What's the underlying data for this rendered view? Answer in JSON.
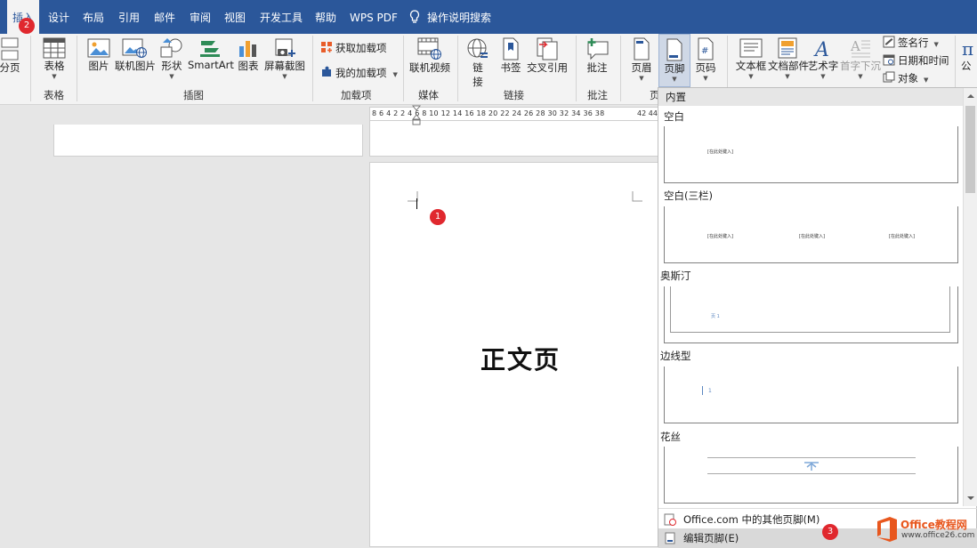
{
  "tabs": [
    "插入",
    "设计",
    "布局",
    "引用",
    "邮件",
    "审阅",
    "视图",
    "开发工具",
    "帮助",
    "WPS PDF",
    "操作说明搜索"
  ],
  "ribbon": {
    "page_break": "分页",
    "table": "表格",
    "picture": "图片",
    "online_picture": "联机图片",
    "shapes": "形状",
    "smartart": "SmartArt",
    "chart": "图表",
    "screenshot": "屏幕截图",
    "get_addins": "获取加载项",
    "my_addins": "我的加载项",
    "online_video": "联机视频",
    "link_1": "链",
    "link_2": "接",
    "bookmark": "书签",
    "cross_ref": "交叉引用",
    "comment": "批注",
    "header": "页眉",
    "footer": "页脚",
    "page_number": "页码",
    "textbox": "文本框",
    "quick_parts": "文档部件",
    "wordart": "艺术字",
    "dropcap": "首字下沉",
    "signature": "签名行",
    "datetime": "日期和时间",
    "object": "对象",
    "equation": "公"
  },
  "groups": {
    "tables": "表格",
    "illustrations": "插图",
    "addins": "加载项",
    "media": "媒体",
    "links": "链接",
    "comments": "批注",
    "header_footer": "页"
  },
  "ruler": {
    "numbers": "8  6  4  2     2  4  6  8 10 12 14 16 18 20 22 24 26 28 30 32 34 36 38",
    "right": "42 44"
  },
  "document": {
    "body_text": "正文页"
  },
  "gallery": {
    "section": "内置",
    "items": [
      {
        "name": "空白",
        "placeholders": [
          "[在此处键入]"
        ]
      },
      {
        "name": "空白(三栏)",
        "placeholders": [
          "[在此处键入]",
          "[在此处键入]",
          "[在此处键入]"
        ]
      },
      {
        "name": "奥斯汀",
        "placeholders": [
          "页 1"
        ]
      },
      {
        "name": "边线型",
        "placeholders": [
          "1"
        ]
      },
      {
        "name": "花丝",
        "placeholders": []
      }
    ],
    "more_footers": "Office.com 中的其他页脚(M)",
    "edit_footer": "编辑页脚(E)"
  },
  "badges": [
    "1",
    "2",
    "3"
  ],
  "watermark": {
    "brand": "Office教程网",
    "url": "www.office26.com"
  },
  "colors": {
    "tab_bar": "#2b579a",
    "badge": "#e0282e",
    "active_button": "#cfd8e6"
  }
}
